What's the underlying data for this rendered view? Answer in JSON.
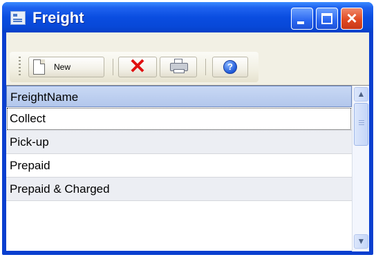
{
  "window": {
    "title": "Freight",
    "controls": {
      "minimize": "minimize",
      "maximize": "maximize",
      "close": "×"
    }
  },
  "toolbar": {
    "new_label": "New",
    "delete_icon": "✕",
    "print_icon": "printer-icon",
    "help_icon": "?"
  },
  "grid": {
    "column_header": "FreightName",
    "rows": [
      "Collect",
      "Pick-up",
      "Prepaid",
      "Prepaid & Charged"
    ],
    "scroll_up": "▲",
    "scroll_down": "▼"
  },
  "colors": {
    "titlebar": "#0a4de0",
    "close_button": "#e04a22",
    "header_bg": "#b3c7ec"
  }
}
